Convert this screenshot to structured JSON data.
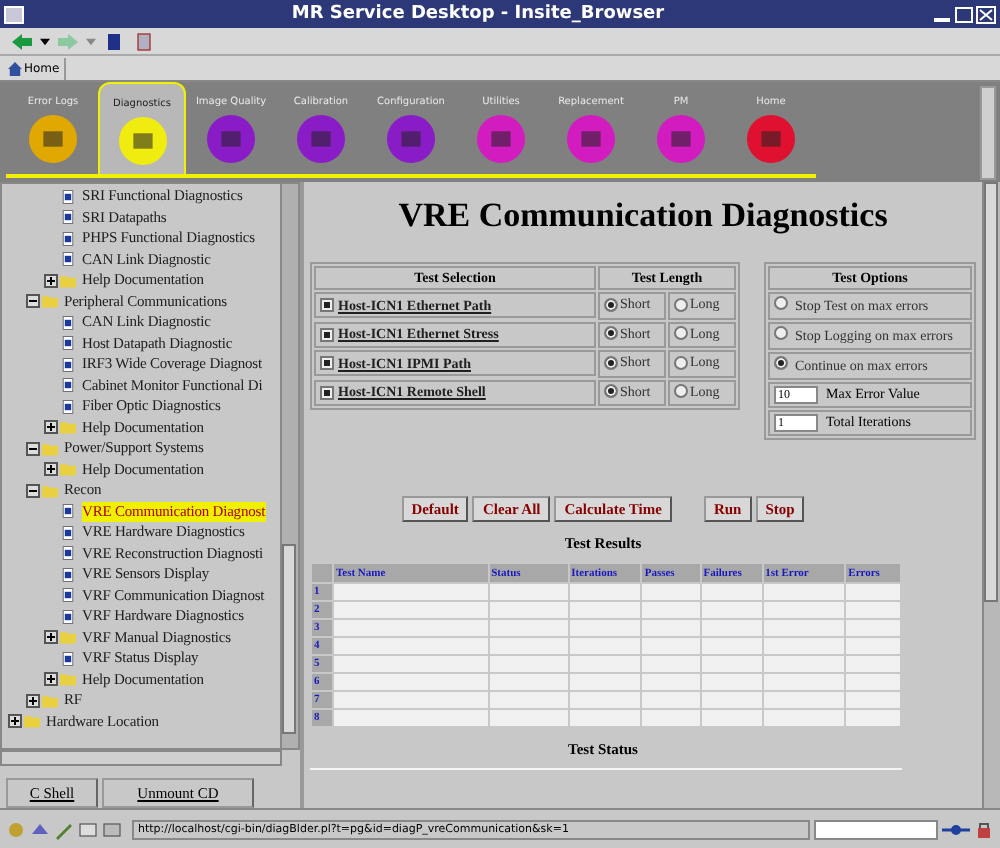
{
  "window": {
    "title": "MR Service Desktop - Insite_Browser"
  },
  "location_bar": {
    "home": "Home"
  },
  "nav_tabs": [
    {
      "label": "Error Logs",
      "selected": false,
      "color": "#e0a800"
    },
    {
      "label": "Diagnostics",
      "selected": true,
      "color": "#f0ec10"
    },
    {
      "label": "Image Quality",
      "selected": false,
      "color": "#8a1cc8"
    },
    {
      "label": "Calibration",
      "selected": false,
      "color": "#8a1cc8"
    },
    {
      "label": "Configuration",
      "selected": false,
      "color": "#8a1cc8"
    },
    {
      "label": "Utilities",
      "selected": false,
      "color": "#d21cc0"
    },
    {
      "label": "Replacement",
      "selected": false,
      "color": "#d21cc0"
    },
    {
      "label": "PM",
      "selected": false,
      "color": "#d21cc0"
    },
    {
      "label": "Home",
      "selected": false,
      "color": "#e01030"
    }
  ],
  "tree": {
    "items": [
      {
        "children": [
          {
            "children": [
              {
                "label": "SRI Functional Diagnostics",
                "kind": "page",
                "selected": false
              },
              {
                "label": "SRI Datapaths",
                "kind": "page",
                "selected": false
              },
              {
                "label": "PHPS Functional Diagnostics",
                "kind": "page",
                "selected": false
              },
              {
                "label": "CAN Link Diagnostic",
                "kind": "page",
                "selected": false
              },
              {
                "label": "Help Documentation",
                "kind": "folder",
                "expanded": false,
                "selected": false
              }
            ]
          },
          {
            "label": "Peripheral Communications",
            "kind": "folder",
            "expanded": true,
            "selected": false,
            "children": [
              {
                "label": "CAN Link Diagnostic",
                "kind": "page",
                "selected": false
              },
              {
                "label": "Host Datapath Diagnostic",
                "kind": "page",
                "selected": false
              },
              {
                "label": "IRF3 Wide Coverage Diagnost",
                "kind": "page",
                "selected": false
              },
              {
                "label": "Cabinet Monitor Functional Di",
                "kind": "page",
                "selected": false
              },
              {
                "label": "Fiber Optic Diagnostics",
                "kind": "page",
                "selected": false
              },
              {
                "label": "Help Documentation",
                "kind": "folder",
                "expanded": false,
                "selected": false
              }
            ]
          },
          {
            "label": "Power/Support Systems",
            "kind": "folder",
            "expanded": true,
            "selected": false,
            "children": [
              {
                "label": "Help Documentation",
                "kind": "folder",
                "expanded": false,
                "selected": false
              }
            ]
          },
          {
            "label": "Recon",
            "kind": "folder",
            "expanded": true,
            "selected": false,
            "children": [
              {
                "label": "VRE Communication Diagnost",
                "kind": "page",
                "selected": true
              },
              {
                "label": "VRE Hardware Diagnostics",
                "kind": "page",
                "selected": false
              },
              {
                "label": "VRE Reconstruction Diagnosti",
                "kind": "page",
                "selected": false
              },
              {
                "label": "VRE Sensors Display",
                "kind": "page",
                "selected": false
              },
              {
                "label": "VRF Communication Diagnost",
                "kind": "page",
                "selected": false
              },
              {
                "label": "VRF Hardware Diagnostics",
                "kind": "page",
                "selected": false
              },
              {
                "label": "VRF Manual Diagnostics",
                "kind": "folder",
                "expanded": false,
                "selected": false
              },
              {
                "label": "VRF Status Display",
                "kind": "page",
                "selected": false
              },
              {
                "label": "Help Documentation",
                "kind": "folder",
                "expanded": false,
                "selected": false
              }
            ]
          },
          {
            "label": "RF",
            "kind": "folder",
            "expanded": false,
            "selected": false
          }
        ]
      },
      {
        "label": "Hardware Location",
        "kind": "folder",
        "expanded": false,
        "selected": false
      }
    ]
  },
  "panel_buttons": [
    "C Shell",
    "Unmount CD"
  ],
  "page": {
    "title": "VRE Communication Diagnostics",
    "test_table": {
      "columns": [
        "Test Selection",
        "Test Length"
      ],
      "rows": [
        {
          "name": "Host-ICN1 Ethernet Path",
          "checked": true,
          "short": "Short",
          "long": "Long",
          "short_selected": true
        },
        {
          "name": "Host-ICN1 Ethernet Stress",
          "checked": true,
          "short": "Short",
          "long": "Long",
          "short_selected": true
        },
        {
          "name": "Host-ICN1 IPMI Path",
          "checked": true,
          "short": "Short",
          "long": "Long",
          "short_selected": true
        },
        {
          "name": "Host-ICN1 Remote Shell",
          "checked": true,
          "short": "Short",
          "long": "Long",
          "short_selected": true
        }
      ]
    },
    "options": {
      "title": "Test Options",
      "radios": [
        {
          "label": "Stop Test on max errors",
          "selected": false
        },
        {
          "label": "Stop Logging on max errors",
          "selected": false
        },
        {
          "label": "Continue on max errors",
          "selected": true
        }
      ],
      "fields": [
        {
          "value": "10",
          "label": "Max Error Value"
        },
        {
          "value": "1",
          "label": "Total Iterations"
        }
      ]
    },
    "buttons": [
      [
        "Default",
        "Clear All",
        "Calculate Time"
      ],
      [
        "Run",
        "Stop"
      ]
    ],
    "results": {
      "title": "Test Results",
      "columns": [
        "Test Name",
        "Status",
        "Iterations",
        "Passes",
        "Failures",
        "1st Error",
        "Errors"
      ],
      "rows": [
        "1",
        "2",
        "3",
        "4",
        "5",
        "6",
        "7",
        "8"
      ]
    },
    "status_title": "Test Status"
  },
  "status_bar": {
    "url": "http://localhost/cgi-bin/diagBlder.pl?t=pg&id=diagP_vreCommunication&sk=1"
  }
}
